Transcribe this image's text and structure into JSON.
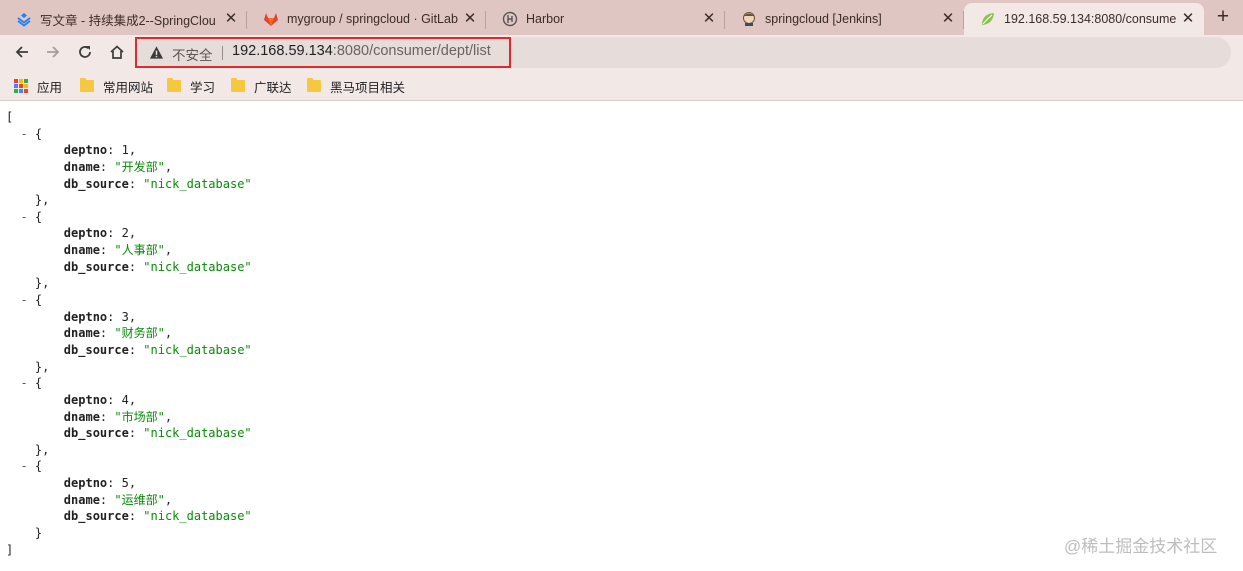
{
  "tabs": [
    {
      "title": "写文章 - 持续集成2--SpringClou",
      "icon": "juejin-icon"
    },
    {
      "title": "mygroup / springcloud · GitLab",
      "icon": "gitlab-icon"
    },
    {
      "title": "Harbor",
      "icon": "harbor-icon"
    },
    {
      "title": "springcloud [Jenkins]",
      "icon": "jenkins-icon"
    },
    {
      "title": "192.168.59.134:8080/consume",
      "icon": "spring-leaf-icon"
    }
  ],
  "omnibox": {
    "security_label": "不安全",
    "url_host": "192.168.59.134",
    "url_rest": ":8080/consumer/dept/list"
  },
  "bookmarks": {
    "apps": "应用",
    "items": [
      "常用网站",
      "学习",
      "广联达",
      "黑马项目相关"
    ]
  },
  "json_view": {
    "records": [
      {
        "deptno": 1,
        "dname": "开发部",
        "db_source": "nick_database"
      },
      {
        "deptno": 2,
        "dname": "人事部",
        "db_source": "nick_database"
      },
      {
        "deptno": 3,
        "dname": "财务部",
        "db_source": "nick_database"
      },
      {
        "deptno": 4,
        "dname": "市场部",
        "db_source": "nick_database"
      },
      {
        "deptno": 5,
        "dname": "运维部",
        "db_source": "nick_database"
      }
    ]
  },
  "watermark": "@稀土掘金技术社区",
  "colors": {
    "tabstrip": "#dfc6c2",
    "toolbar": "#f2e8e6",
    "highlight_box": "#dd2b2b",
    "json_string": "#0a8a0a"
  }
}
